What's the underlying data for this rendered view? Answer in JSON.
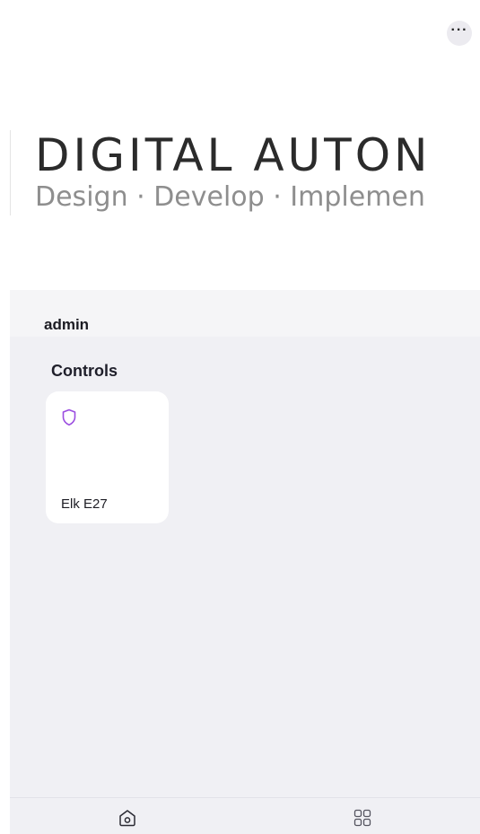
{
  "header": {
    "more_icon": "ellipsis-icon",
    "more_label": "···"
  },
  "logo": {
    "title": "DIGITAL AUTON",
    "tagline": "Design · Develop · Implemen"
  },
  "topbar": {
    "username": "admin"
  },
  "section": {
    "title": "Controls"
  },
  "cards": [
    {
      "label": "Elk E27",
      "icon": "shield-icon",
      "icon_color": "#9b4de0"
    }
  ],
  "bottom_nav": [
    {
      "icon": "home-icon"
    },
    {
      "icon": "grid-icon"
    }
  ]
}
